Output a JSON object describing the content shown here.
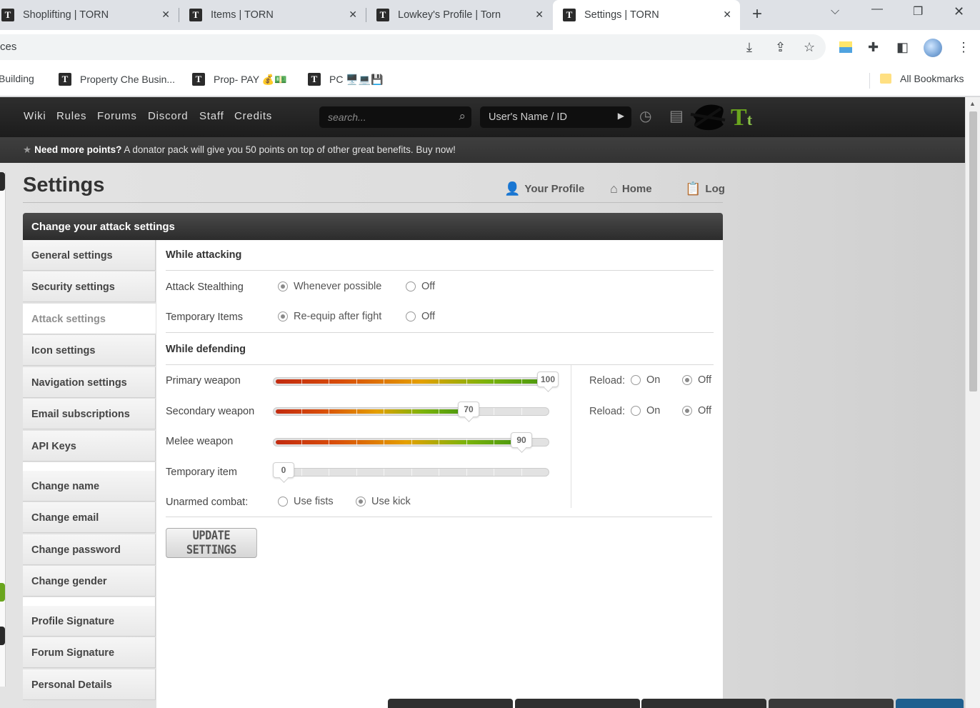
{
  "browser": {
    "tabs": [
      {
        "title": "Shoplifting | TORN",
        "favicon": "T"
      },
      {
        "title": "Items | TORN",
        "favicon": "T"
      },
      {
        "title": "Lowkey's Profile | Torn",
        "favicon": "T"
      },
      {
        "title": "Settings | TORN",
        "favicon": "T",
        "active": true
      }
    ],
    "new_tab": "+",
    "address_partial": "ces",
    "bookmarks": [
      {
        "label": "Building"
      },
      {
        "label": "Property Che Busin...",
        "favicon": "T"
      },
      {
        "label": "Prop- PAY 💰💵",
        "favicon": "T"
      },
      {
        "label": "PC 🖥️💻💾",
        "favicon": "T"
      }
    ],
    "all_bookmarks": "All Bookmarks"
  },
  "nav": {
    "links": [
      "Wiki",
      "Rules",
      "Forums",
      "Discord",
      "Staff",
      "Credits"
    ],
    "search_placeholder": "search...",
    "user_input": "User's Name / ID"
  },
  "banner": {
    "bold": "Need more points?",
    "text": " A donator pack will give you 50 points on top of other great benefits. Buy now!"
  },
  "page": {
    "title": "Settings",
    "links": [
      "Your Profile",
      "Home",
      "Log"
    ]
  },
  "panel": {
    "header": "Change your attack settings"
  },
  "sidebar": {
    "items": [
      "General settings",
      "Security settings",
      "Attack settings",
      "Icon settings",
      "Navigation settings",
      "Email subscriptions",
      "API Keys",
      "Change name",
      "Change email",
      "Change password",
      "Change gender",
      "Profile Signature",
      "Forum Signature",
      "Personal Details"
    ],
    "active": "Attack settings"
  },
  "attacking": {
    "title": "While attacking",
    "rows": [
      {
        "label": "Attack Stealthing",
        "options": [
          "Whenever possible",
          "Off"
        ],
        "selected": 0
      },
      {
        "label": "Temporary Items",
        "options": [
          "Re-equip after fight",
          "Off"
        ],
        "selected": 0
      }
    ]
  },
  "defending": {
    "title": "While defending",
    "sliders": [
      {
        "label": "Primary weapon",
        "value": 100,
        "value_text": "100",
        "reload": "Off"
      },
      {
        "label": "Secondary weapon",
        "value": 70,
        "value_text": "70",
        "reload": "Off"
      },
      {
        "label": "Melee weapon",
        "value": 90,
        "value_text": "90"
      },
      {
        "label": "Temporary item",
        "value": 0,
        "value_text": "0"
      }
    ],
    "reload_label": "Reload:",
    "reload_on": "On",
    "reload_off": "Off",
    "unarmed": {
      "label": "Unarmed combat:",
      "options": [
        "Use fists",
        "Use kick"
      ],
      "selected": 1
    }
  },
  "update_button": "UPDATE SETTINGS",
  "colors": {
    "nav_bg": "#1c1c1c",
    "logo_green": "#6aa51e",
    "slider_red": "#c22b10",
    "slider_green": "#4e9a0e"
  }
}
